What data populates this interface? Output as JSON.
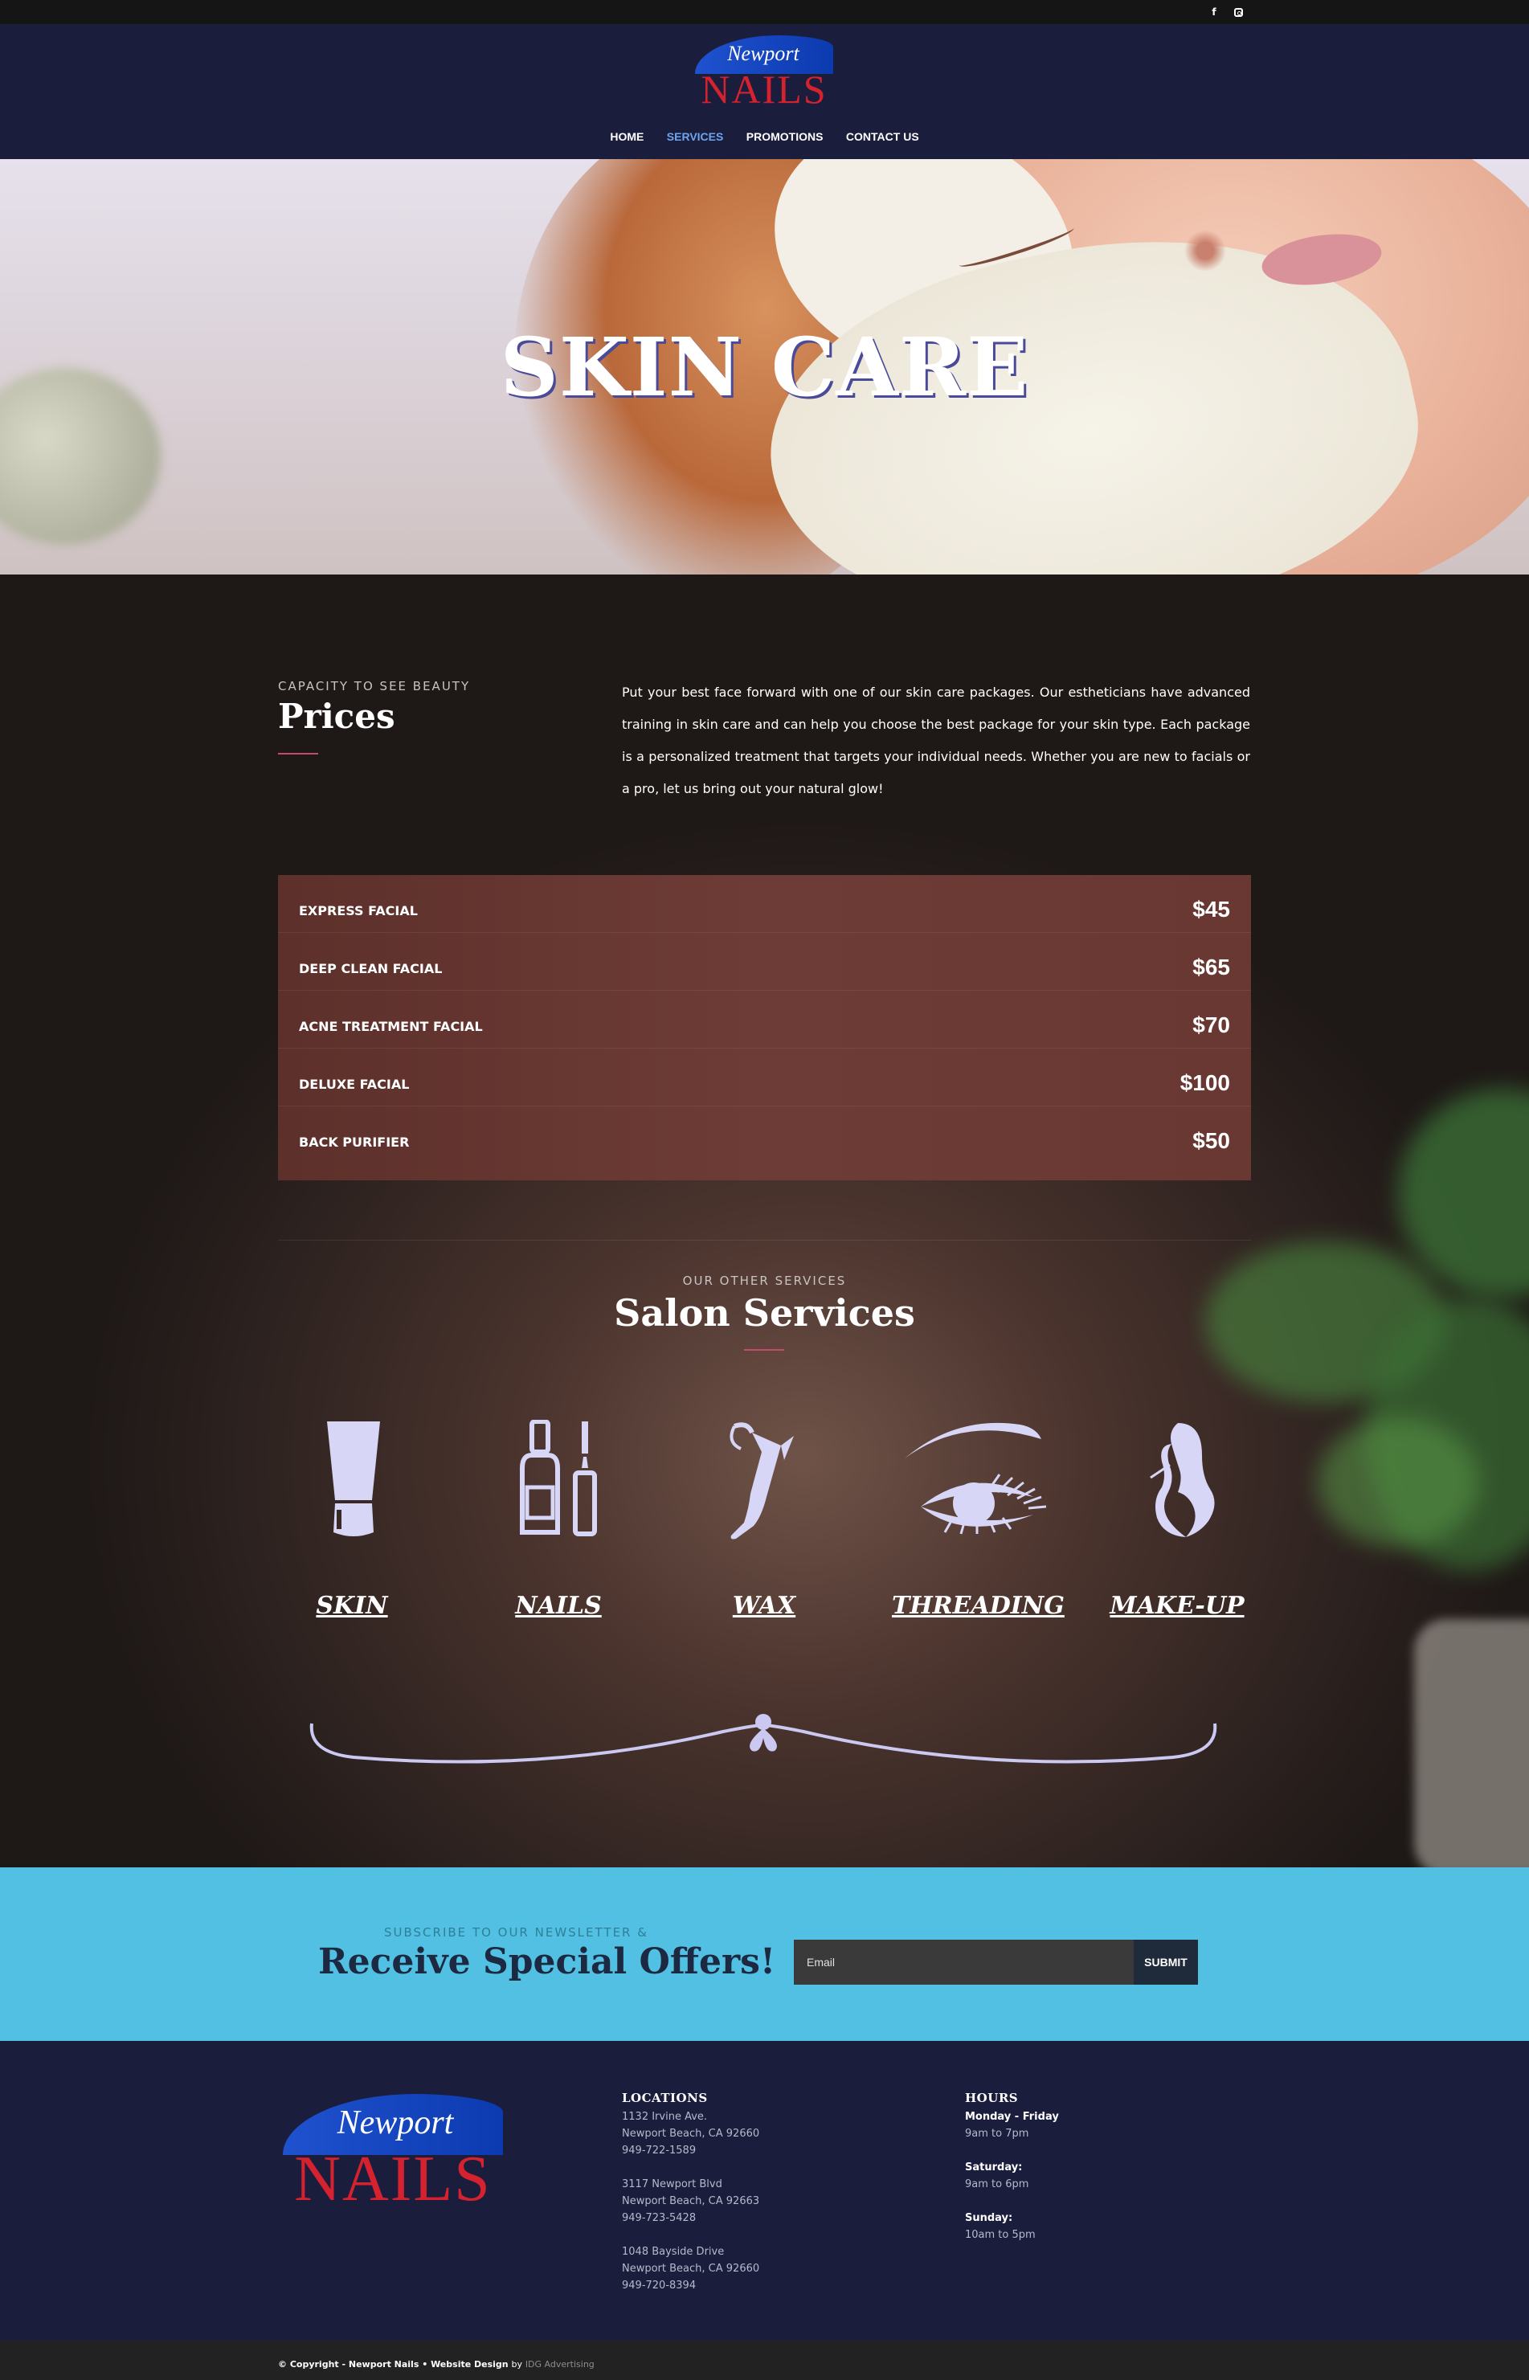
{
  "topbar": {
    "social": [
      {
        "icon": "facebook-icon",
        "glyph": "f"
      },
      {
        "icon": "instagram-icon"
      }
    ]
  },
  "logo": {
    "script": "Newport",
    "name": "NAILS"
  },
  "nav": {
    "items": [
      {
        "label": "HOME",
        "active": false
      },
      {
        "label": "SERVICES",
        "active": true
      },
      {
        "label": "PROMOTIONS",
        "active": false
      },
      {
        "label": "CONTACT US",
        "active": false
      }
    ]
  },
  "hero": {
    "title": "SKIN CARE"
  },
  "prices": {
    "eyebrow": "CAPACITY TO SEE BEAUTY",
    "title": "Prices",
    "intro": "Put your best face forward with one of our skin care packages. Our estheticians have advanced training in skin care and can help you choose the best package for your skin type. Each package is a personalized treatment that targets your individual needs. Whether you are new to facials or a pro, let us bring out your natural glow!",
    "items": [
      {
        "name": "EXPRESS FACIAL",
        "price": "$45"
      },
      {
        "name": "DEEP CLEAN FACIAL",
        "price": "$65"
      },
      {
        "name": "ACNE TREATMENT FACIAL",
        "price": "$70"
      },
      {
        "name": "DELUXE FACIAL",
        "price": "$100"
      },
      {
        "name": "BACK PURIFIER",
        "price": "$50"
      }
    ]
  },
  "services": {
    "eyebrow": "OUR OTHER SERVICES",
    "title": "Salon Services",
    "items": [
      {
        "label": "SKIN",
        "icon": "lotion-tube-icon"
      },
      {
        "label": "NAILS",
        "icon": "nail-polish-icon"
      },
      {
        "label": "WAX",
        "icon": "leg-wax-icon"
      },
      {
        "label": "THREADING",
        "icon": "eye-lash-icon"
      },
      {
        "label": "MAKE-UP",
        "icon": "woman-hair-icon"
      }
    ]
  },
  "newsletter": {
    "eyebrow": "SUBSCRIBE TO OUR NEWSLETTER &",
    "title": "Receive Special Offers!",
    "email_placeholder": "Email",
    "submit_label": "SUBMIT"
  },
  "footer": {
    "locations_title": "LOCATIONS",
    "locations": [
      {
        "line1": "1132 Irvine Ave.",
        "line2": "Newport Beach, CA 92660",
        "phone": "949-722-1589"
      },
      {
        "line1": "3117 Newport Blvd",
        "line2": "Newport Beach, CA 92663",
        "phone": "949-723-5428"
      },
      {
        "line1": "1048 Bayside Drive",
        "line2": "Newport Beach, CA 92660",
        "phone": "949-720-8394"
      }
    ],
    "hours_title": "HOURS",
    "hours": [
      {
        "day": "Monday - Friday",
        "time": "9am to 7pm"
      },
      {
        "day": "Saturday:",
        "time": "9am to 6pm"
      },
      {
        "day": "Sunday:",
        "time": "10am to 5pm"
      }
    ]
  },
  "copyright": {
    "text": "© Copyright - Newport Nails • Website Design",
    "by": "by",
    "link": "IDG Advertising"
  },
  "colors": {
    "navy": "#1b1d3c",
    "nav_active": "#6ea5f0",
    "accent_pink": "#c64a6c",
    "price_panel": "#6e3c36",
    "newsletter_bg": "#51c0e2",
    "logo_red": "#d4222e",
    "logo_blue": "#1f52cf",
    "icon_lavender": "#d8d6f7"
  }
}
